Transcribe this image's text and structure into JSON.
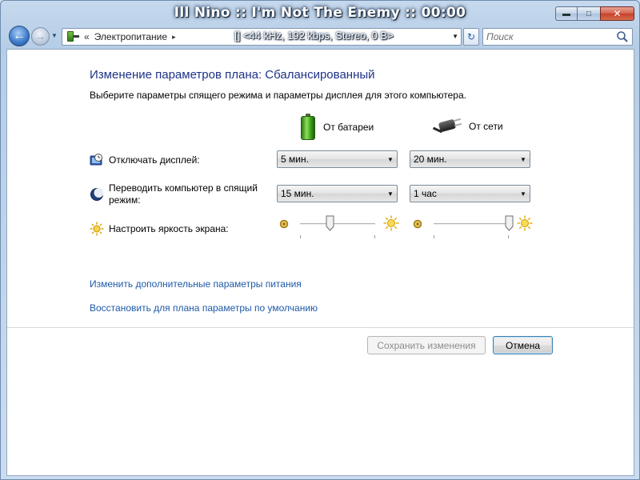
{
  "window": {
    "title": "Ill Nino :: I'm Not The Enemy :: 00:00",
    "controls": {
      "minimize": "▬",
      "maximize": "□",
      "close": "✕"
    }
  },
  "nav": {
    "back_icon": "back-arrow-icon",
    "forward_icon": "forward-arrow-icon",
    "breadcrumb_sep": "«",
    "breadcrumb": "Электропитание",
    "breadcrumb_overflow": "▸",
    "overlay_text": "[] <44 kHz, 192 kbps, Stereo, 0 B>",
    "search_placeholder": "Поиск"
  },
  "page": {
    "heading": "Изменение параметров плана: Сбалансированный",
    "subheading": "Выберите параметры спящего режима и параметры дисплея для этого компьютера.",
    "col_battery": "От батареи",
    "col_ac": "От сети"
  },
  "settings": {
    "display_off": {
      "label": "Отключать дисплей:",
      "battery": "5 мин.",
      "ac": "20 мин."
    },
    "sleep": {
      "label_line1": "Переводить компьютер в спящий",
      "label_line2": "режим:",
      "battery": "15 мин.",
      "ac": "1 час"
    },
    "brightness": {
      "label": "Настроить яркость экрана:",
      "battery_level": 0.4,
      "ac_level": 1.0
    }
  },
  "links": {
    "advanced": "Изменить дополнительные параметры питания",
    "restore": "Восстановить для плана параметры по умолчанию"
  },
  "buttons": {
    "save": "Сохранить изменения",
    "cancel": "Отмена"
  },
  "colors": {
    "heading": "#1e3287",
    "link": "#1e5aa8",
    "accent": "#3a78c8"
  }
}
